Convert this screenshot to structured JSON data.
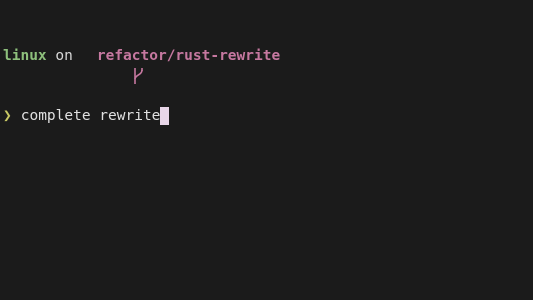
{
  "prompt": {
    "directory": "linux",
    "on_word": "on",
    "branch_icon": "git-branch-icon",
    "branch": "refactor/rust-rewrite"
  },
  "input": {
    "prompt_symbol": "❯",
    "text": "complete rewrite"
  },
  "colors": {
    "background": "#1b1b1b",
    "directory": "#8ec07c",
    "branch": "#c678a0",
    "prompt_symbol": "#c8c864",
    "cursor": "#e8d6e8"
  }
}
